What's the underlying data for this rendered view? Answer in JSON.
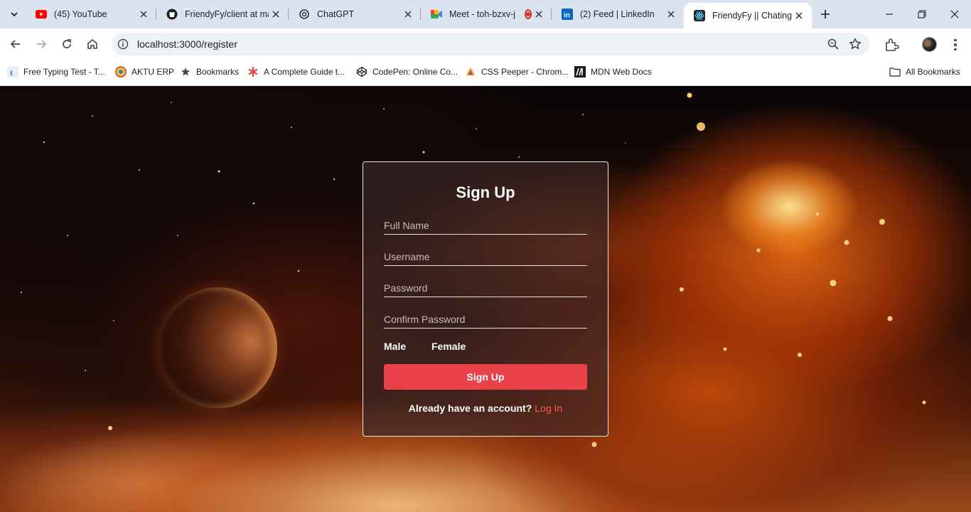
{
  "browser": {
    "tabs": [
      {
        "title": "(45) YouTube",
        "icon": "youtube-icon"
      },
      {
        "title": "FriendyFy/client at ma",
        "icon": "github-icon"
      },
      {
        "title": "ChatGPT",
        "icon": "chatgpt-icon"
      },
      {
        "title": "Meet - toh-bzxv-j",
        "icon": "google-meet-icon"
      },
      {
        "title": "(2) Feed | LinkedIn",
        "icon": "linkedin-icon"
      },
      {
        "title": "FriendyFy || Chating A",
        "icon": "react-icon",
        "active": true
      }
    ],
    "url": "localhost:3000/register",
    "bookmarks": [
      {
        "label": "Free Typing Test - T...",
        "icon": "typing-test-icon"
      },
      {
        "label": "AKTU ERP",
        "icon": "aktu-icon"
      },
      {
        "label": "Bookmarks",
        "icon": "star-icon"
      },
      {
        "label": "A Complete Guide t...",
        "icon": "asterisk-icon"
      },
      {
        "label": "CodePen: Online Co...",
        "icon": "codepen-icon"
      },
      {
        "label": "CSS Peeper - Chrom...",
        "icon": "css-peeper-icon"
      },
      {
        "label": "MDN Web Docs",
        "icon": "mdn-icon"
      }
    ],
    "all_bookmarks": "All Bookmarks"
  },
  "signup": {
    "title": "Sign Up",
    "full_name_placeholder": "Full Name",
    "username_placeholder": "Username",
    "password_placeholder": "Password",
    "confirm_password_placeholder": "Confirm Password",
    "gender_male": "Male",
    "gender_female": "Female",
    "submit_label": "Sign Up",
    "already_text": "Already have an account?",
    "login_link": "Log In"
  },
  "colors": {
    "accent": "#e9424a",
    "link": "#ff5a4f"
  }
}
